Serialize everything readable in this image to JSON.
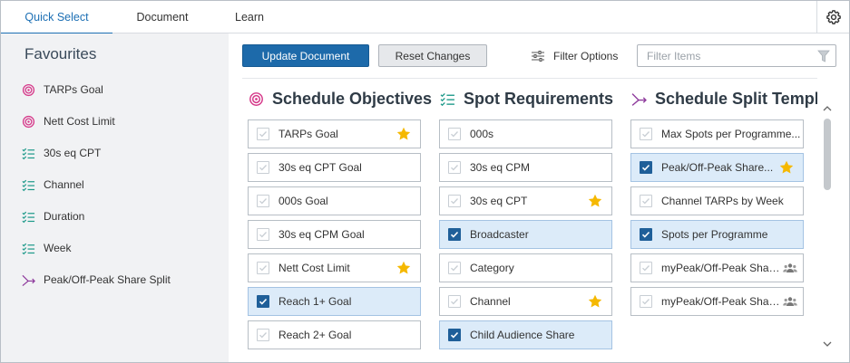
{
  "tabs": [
    {
      "label": "Quick Select",
      "active": true
    },
    {
      "label": "Document",
      "active": false
    },
    {
      "label": "Learn",
      "active": false
    }
  ],
  "settings_icon": "gear-icon",
  "sidebar": {
    "title": "Favourites",
    "items": [
      {
        "label": "TARPs Goal",
        "icon": "target-icon"
      },
      {
        "label": "Nett Cost Limit",
        "icon": "target-icon"
      },
      {
        "label": "30s eq CPT",
        "icon": "checklist-icon"
      },
      {
        "label": "Channel",
        "icon": "checklist-icon"
      },
      {
        "label": "Duration",
        "icon": "checklist-icon"
      },
      {
        "label": "Week",
        "icon": "checklist-icon"
      },
      {
        "label": "Peak/Off-Peak Share Split",
        "icon": "split-icon"
      }
    ]
  },
  "toolbar": {
    "update_label": "Update Document",
    "reset_label": "Reset Changes",
    "filter_options_label": "Filter Options",
    "filter_placeholder": "Filter Items",
    "filter_value": ""
  },
  "columns": [
    {
      "title": "Schedule Objectives",
      "icon": "target-icon",
      "items": [
        {
          "label": "TARPs Goal",
          "checked": false,
          "favourite": true,
          "group": false
        },
        {
          "label": "30s eq CPT Goal",
          "checked": false,
          "favourite": false,
          "group": false
        },
        {
          "label": "000s Goal",
          "checked": false,
          "favourite": false,
          "group": false
        },
        {
          "label": "30s eq CPM Goal",
          "checked": false,
          "favourite": false,
          "group": false
        },
        {
          "label": "Nett Cost Limit",
          "checked": false,
          "favourite": true,
          "group": false
        },
        {
          "label": "Reach 1+ Goal",
          "checked": true,
          "favourite": false,
          "group": false
        },
        {
          "label": "Reach 2+ Goal",
          "checked": false,
          "favourite": false,
          "group": false
        }
      ]
    },
    {
      "title": "Spot Requirements",
      "icon": "checklist-icon",
      "items": [
        {
          "label": "000s",
          "checked": false,
          "favourite": false,
          "group": false
        },
        {
          "label": "30s eq CPM",
          "checked": false,
          "favourite": false,
          "group": false
        },
        {
          "label": "30s eq CPT",
          "checked": false,
          "favourite": true,
          "group": false
        },
        {
          "label": "Broadcaster",
          "checked": true,
          "favourite": false,
          "group": false
        },
        {
          "label": "Category",
          "checked": false,
          "favourite": false,
          "group": false
        },
        {
          "label": "Channel",
          "checked": false,
          "favourite": true,
          "group": false
        },
        {
          "label": "Child Audience Share",
          "checked": true,
          "favourite": false,
          "group": false
        }
      ]
    },
    {
      "title": "Schedule Split Templates",
      "icon": "split-icon",
      "items": [
        {
          "label": "Max Spots per Programme...",
          "checked": false,
          "favourite": false,
          "group": false
        },
        {
          "label": "Peak/Off-Peak Share...",
          "checked": true,
          "favourite": true,
          "group": false
        },
        {
          "label": "Channel TARPs by Week",
          "checked": false,
          "favourite": false,
          "group": false
        },
        {
          "label": "Spots per Programme",
          "checked": true,
          "favourite": false,
          "group": false
        },
        {
          "label": "myPeak/Off-Peak Share...",
          "checked": false,
          "favourite": false,
          "group": true
        },
        {
          "label": "myPeak/Off-Peak Share...",
          "checked": false,
          "favourite": false,
          "group": true
        }
      ]
    }
  ],
  "colors": {
    "accent": "#1c6fb4",
    "primary_button": "#1d6aaa",
    "target_icon": "#d63a8a",
    "checklist_icon": "#1e9a8a",
    "split_icon": "#8e3a9c",
    "star": "#f5b800",
    "checked_bg": "#dcebf9",
    "checkbox_checked": "#1f5f99"
  }
}
